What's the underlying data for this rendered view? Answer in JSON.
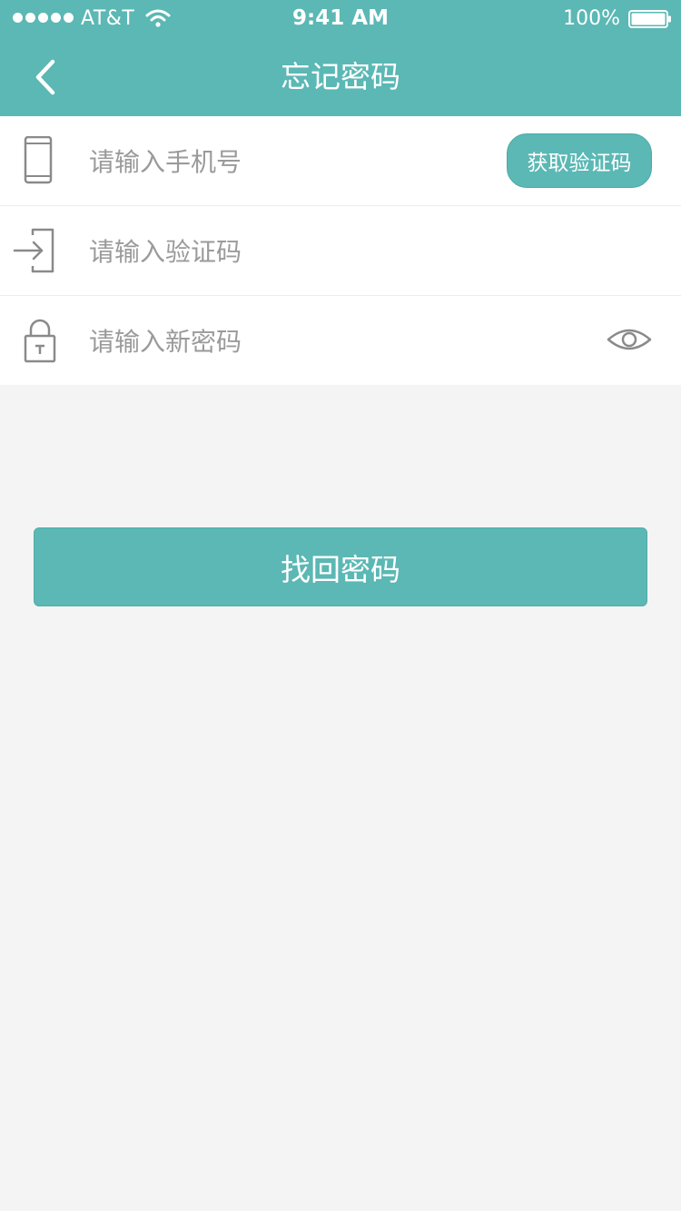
{
  "status_bar": {
    "carrier": "AT&T",
    "time": "9:41 AM",
    "battery": "100%"
  },
  "nav": {
    "title": "忘记密码",
    "back_icon": "chevron-left-icon"
  },
  "form": {
    "phone": {
      "icon": "phone-icon",
      "placeholder": "请输入手机号",
      "value": "",
      "code_button_label": "获取验证码"
    },
    "code": {
      "icon": "login-arrow-icon",
      "placeholder": "请输入验证码",
      "value": ""
    },
    "password": {
      "icon": "lock-icon",
      "placeholder": "请输入新密码",
      "value": "",
      "visibility_icon": "eye-icon"
    }
  },
  "submit": {
    "label": "找回密码"
  },
  "colors": {
    "accent": "#5bb8b4",
    "background": "#f4f4f4",
    "placeholder": "#9a9a9a"
  }
}
